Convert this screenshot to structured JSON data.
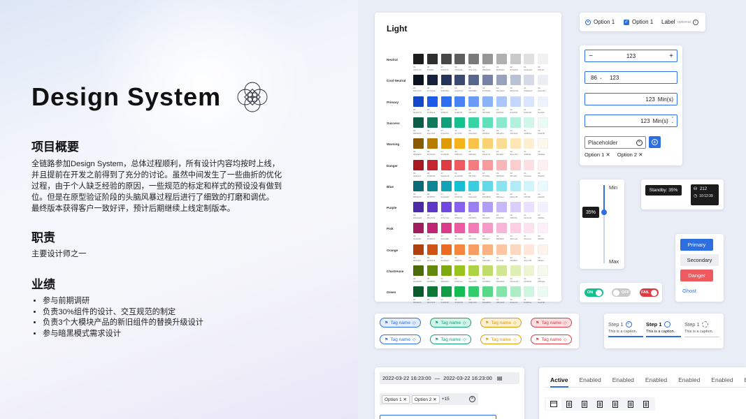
{
  "left": {
    "title": "Design System",
    "overview_heading": "项目概要",
    "overview_lines": [
      "全链路参加Design System，总体过程顺利，所有设计内容均按时上线，",
      "并且提前在开发之前得到了充分的讨论。虽然中间发生了一些曲折的优化",
      "过程，由于个人缺乏经验的原因，一些规范的标定和样式的预设没有做到",
      "位。但是在原型验证阶段的头脑风暴过程后进行了细致的打磨和调优。",
      "最终版本获得客户一致好评，预计后期继续上线定制版本。"
    ],
    "role_heading": "职责",
    "role_text": "主要设计师之一",
    "achievement_heading": "业绩",
    "achievements": [
      "参与前期调研",
      "负责30%组件的设计、交互规范的制定",
      "负责3个大模块产品的新旧组件的替换升级设计",
      "参与暗黑模式需求设计"
    ]
  },
  "palette": {
    "title": "Light",
    "steps": [
      "09",
      "08",
      "07",
      "06",
      "05",
      "04",
      "03",
      "02",
      "01",
      "00"
    ],
    "rows": [
      {
        "label": "Neutral",
        "colors": [
          "#1b1b1b",
          "#2f2f2f",
          "#474747",
          "#5e5e5e",
          "#7a7a7a",
          "#969696",
          "#b0b0b0",
          "#c9c9c9",
          "#e0e0e0",
          "#f1f1f1"
        ]
      },
      {
        "label": "Cool Neutral",
        "colors": [
          "#0b1220",
          "#17223a",
          "#26345a",
          "#3a4a73",
          "#56668d",
          "#7483a6",
          "#97a3bd",
          "#b9c2d4",
          "#d5dbe6",
          "#ebeef4"
        ]
      },
      {
        "label": "Primary",
        "colors": [
          "#1447c9",
          "#1d5ae6",
          "#2f6ef0",
          "#4a84f4",
          "#6b9bf6",
          "#8cb2f8",
          "#a9c5fa",
          "#c3d6fb",
          "#d9e6fd",
          "#ecf2fe"
        ]
      },
      {
        "label": "Success",
        "colors": [
          "#0b5d45",
          "#0e7a5b",
          "#11a07a",
          "#17bf8f",
          "#3ad3a5",
          "#5fdfba",
          "#8be8cc",
          "#b1f0dd",
          "#d0f6ea",
          "#e9fbf5"
        ]
      },
      {
        "label": "Warning",
        "colors": [
          "#8a5a00",
          "#b97b00",
          "#e09b00",
          "#f5b21a",
          "#f8c34a",
          "#fad173",
          "#fbdd97",
          "#fce7b5",
          "#fdf0d2",
          "#fef8ea"
        ]
      },
      {
        "label": "Danger",
        "colors": [
          "#a9191f",
          "#c52630",
          "#de3b43",
          "#ee5a60",
          "#f47c80",
          "#f79b9e",
          "#f9b6b8",
          "#fbcdcf",
          "#fce0e1",
          "#fef0f0"
        ]
      },
      {
        "label": "Blue",
        "colors": [
          "#0b6a78",
          "#0d8797",
          "#10a4b6",
          "#16bfd2",
          "#3acde0",
          "#63d8e8",
          "#8be3ef",
          "#b0ecf5",
          "#cff4f9",
          "#e9fafc"
        ]
      },
      {
        "label": "Purple",
        "colors": [
          "#4b2aa8",
          "#5e37c9",
          "#7147e3",
          "#8662ef",
          "#9c80f3",
          "#b29df6",
          "#c6b8f9",
          "#d8cffb",
          "#e7e1fd",
          "#f3f0fe"
        ]
      },
      {
        "label": "Pink",
        "colors": [
          "#a11d5e",
          "#c02574",
          "#dc3a8b",
          "#ec5aa2",
          "#f27bb6",
          "#f59ac7",
          "#f8b6d6",
          "#fbcee3",
          "#fce1ee",
          "#fef0f7"
        ]
      },
      {
        "label": "Orange",
        "colors": [
          "#b0410f",
          "#d05316",
          "#ea6a22",
          "#f5853f",
          "#f89d61",
          "#fab283",
          "#fcc6a3",
          "#fdd8c0",
          "#fee7d9",
          "#fff3ec"
        ]
      },
      {
        "label": "Chartreuse",
        "colors": [
          "#4d6b08",
          "#66890b",
          "#80a910",
          "#99c41e",
          "#aed245",
          "#c0dd6c",
          "#d0e692",
          "#deeeb4",
          "#ebf5d2",
          "#f5faea"
        ]
      },
      {
        "label": "Green",
        "colors": [
          "#0b5a2b",
          "#0e7937",
          "#119b45",
          "#16bb54",
          "#34cc6d",
          "#5ad88a",
          "#86e3a9",
          "#afecc6",
          "#d0f5de",
          "#eafbf0"
        ]
      }
    ]
  },
  "controls": {
    "radio_label": "Option 1",
    "checkbox_label": "Option 1",
    "field_label": "Label",
    "optional_text": "optional",
    "stepper_value": "123",
    "select_value": "86",
    "select_input": "123",
    "min_field_1": "123",
    "min_unit_1": "Min(s)",
    "min_field_2": "123",
    "min_unit_2": "Min(s)",
    "placeholder": "Placeholder",
    "chip_1": "Option 1",
    "chip_2": "Option 2"
  },
  "slider": {
    "min_label": "Min",
    "max_label": "Max",
    "value_label": "35%",
    "value": 0.35
  },
  "standby": {
    "label": "Standby: 35%",
    "count": "212",
    "time": "10:12:39"
  },
  "switches": {
    "on_label": "ON",
    "off_label": "OFF",
    "fail_label": "FAIL"
  },
  "buttons": {
    "primary": "Primary",
    "secondary": "Secondary",
    "danger": "Danger",
    "ghost": "Ghost"
  },
  "tags": {
    "label": "Tag name",
    "colors": [
      "#2d6ee0",
      "#11a07a",
      "#e09b00",
      "#de3b43"
    ]
  },
  "steps": [
    {
      "title": "Step 1",
      "caption": "This is a caption."
    },
    {
      "title": "Step 1",
      "caption": "This is a caption."
    },
    {
      "title": "Step 1",
      "caption": "This is a caption."
    }
  ],
  "date_range": {
    "start": "2022-03-22 16:23:00",
    "separator": "—",
    "end": "2022-03-22 16:23:00"
  },
  "multiselect": {
    "chip_1": "Option 1",
    "chip_2": "Option 2",
    "more": "+15"
  },
  "tabs": {
    "items": [
      "Active",
      "Enabled",
      "Enabled",
      "Enabled",
      "Enabled",
      "Enabled",
      "En"
    ]
  }
}
